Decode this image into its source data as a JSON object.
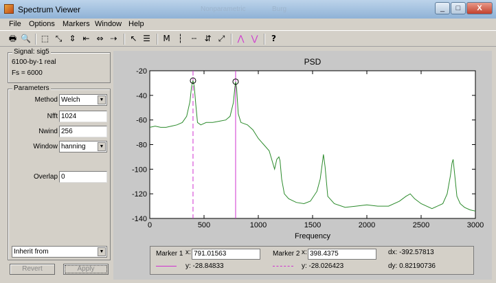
{
  "window": {
    "title": "Spectrum Viewer",
    "background_titles": [
      "Nonparametric",
      "Burg"
    ],
    "controls": {
      "minimize": "_",
      "maximize": "□",
      "close": "X"
    }
  },
  "menu": [
    "File",
    "Options",
    "Markers",
    "Window",
    "Help"
  ],
  "toolbar": [
    {
      "name": "print-icon",
      "glyph": "🖶"
    },
    {
      "name": "print-preview-icon",
      "glyph": "🔍"
    },
    {
      "name": "zoom-box-icon",
      "glyph": "⬚"
    },
    {
      "name": "full-view-icon",
      "glyph": "⤡"
    },
    {
      "name": "zoom-y-icon",
      "glyph": "⇕"
    },
    {
      "name": "zoom-out-x-icon",
      "glyph": "⇤"
    },
    {
      "name": "zoom-in-x-icon",
      "glyph": "⇔"
    },
    {
      "name": "mouse-zoom-icon",
      "glyph": "⇢"
    },
    {
      "name": "select-icon",
      "glyph": "↖"
    },
    {
      "name": "set-linked-icon",
      "glyph": "☰"
    },
    {
      "name": "line-properties-icon",
      "glyph": "≡"
    },
    {
      "name": "markers-icon",
      "glyph": "M"
    },
    {
      "name": "vertical-markers-icon",
      "glyph": "┆"
    },
    {
      "name": "horizontal-markers-icon",
      "glyph": "┄"
    },
    {
      "name": "track-markers-icon",
      "glyph": "⇵"
    },
    {
      "name": "slope-markers-icon",
      "glyph": "⤢"
    },
    {
      "name": "peaks-icon",
      "glyph": "⋀"
    },
    {
      "name": "valleys-icon",
      "glyph": "⋁"
    },
    {
      "name": "whats-this-icon",
      "glyph": "?"
    }
  ],
  "signal": {
    "title": "Signal: sig5",
    "dims": "6100-by-1 real",
    "fs": "Fs = 6000"
  },
  "parameters": {
    "title": "Parameters",
    "method_label": "Method",
    "method_value": "Welch",
    "nfft_label": "Nfft",
    "nfft_value": "1024",
    "nwind_label": "Nwind",
    "nwind_value": "256",
    "window_label": "Window",
    "window_value": "hanning",
    "overlap_label": "Overlap",
    "overlap_value": "0",
    "inherit_value": "Inherit from",
    "revert_label": "Revert",
    "apply_label": "Apply"
  },
  "markers": {
    "marker1_label": "Marker 1",
    "marker1_x_label": "x:",
    "marker1_x": "791.01563",
    "marker1_y": "y: -28.84833",
    "marker2_label": "Marker 2",
    "marker2_x_label": "x:",
    "marker2_x": "398.4375",
    "marker2_y": "y: -28.026423",
    "dx": "dx: -392.57813",
    "dy": "dy: 0.82190736"
  },
  "colors": {
    "trace": "#2a8a2a",
    "marker": "#d030d0"
  },
  "chart_data": {
    "type": "line",
    "title": "PSD",
    "xlabel": "Frequency",
    "ylabel": "",
    "xlim": [
      0,
      3000
    ],
    "ylim": [
      -140,
      -20
    ],
    "xticks": [
      0,
      500,
      1000,
      1500,
      2000,
      2500,
      3000
    ],
    "yticks": [
      -20,
      -40,
      -60,
      -80,
      -100,
      -120,
      -140
    ],
    "grid": false,
    "series": [
      {
        "x": [
          0,
          50,
          100,
          150,
          200,
          250,
          300,
          340,
          370,
          385,
          398,
          410,
          425,
          440,
          470,
          520,
          580,
          640,
          700,
          740,
          770,
          785,
          791,
          800,
          815,
          840,
          900,
          950,
          1000,
          1050,
          1100,
          1150,
          1170,
          1190,
          1200,
          1215,
          1240,
          1280,
          1350,
          1420,
          1480,
          1540,
          1570,
          1590,
          1600,
          1615,
          1640,
          1700,
          1800,
          1900,
          2000,
          2100,
          2200,
          2300,
          2360,
          2400,
          2440,
          2500,
          2600,
          2700,
          2740,
          2770,
          2785,
          2795,
          2810,
          2830,
          2860,
          2900,
          2950,
          3000
        ],
        "y": [
          -66,
          -65,
          -66,
          -66,
          -65,
          -64,
          -62,
          -57,
          -45,
          -33,
          -28,
          -33,
          -48,
          -62,
          -64,
          -62,
          -62,
          -61,
          -60,
          -57,
          -46,
          -33,
          -29,
          -34,
          -55,
          -62,
          -64,
          -68,
          -75,
          -80,
          -85,
          -100,
          -92,
          -90,
          -93,
          -108,
          -120,
          -124,
          -127,
          -128,
          -126,
          -118,
          -108,
          -95,
          -88,
          -98,
          -122,
          -128,
          -131,
          -130,
          -129,
          -130,
          -130,
          -126,
          -122,
          -120,
          -124,
          -128,
          -132,
          -128,
          -120,
          -105,
          -95,
          -92,
          -105,
          -122,
          -128,
          -131,
          -133,
          -134
        ]
      }
    ],
    "marker_x": [
      398.4375,
      791.01563
    ],
    "marker_y": [
      -28.026423,
      -28.84833
    ]
  }
}
